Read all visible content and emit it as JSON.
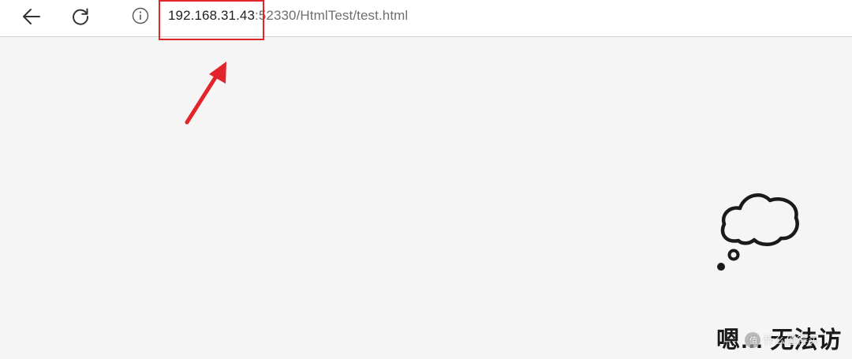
{
  "browser": {
    "back_icon": "back-arrow-icon",
    "refresh_icon": "refresh-icon",
    "info_icon": "info-circle-icon",
    "url_host": "192.168.31.43",
    "url_rest": ":52330/HtmlTest/test.html"
  },
  "annotation": {
    "box_color": "#e2242b",
    "arrow_color": "#e2242b"
  },
  "error_page": {
    "icon": "thought-bubble-icon",
    "heading": "嗯… 无法访"
  },
  "watermark": {
    "text": "什么值得买"
  }
}
